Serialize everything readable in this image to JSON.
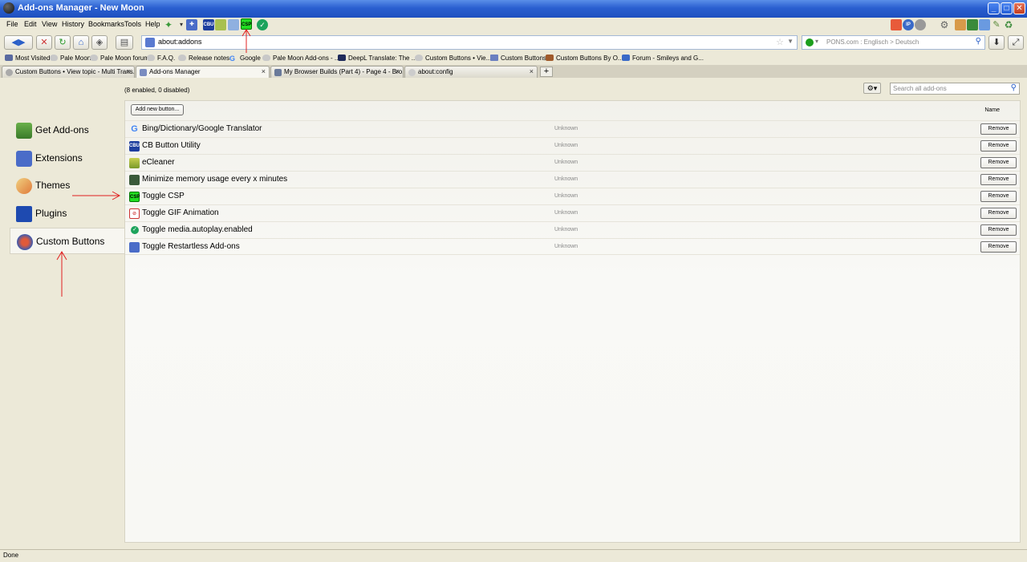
{
  "window": {
    "title": "Add-ons Manager - New Moon",
    "min": "_",
    "max": "□",
    "close": "✕"
  },
  "menu": [
    "File",
    "Edit",
    "View",
    "History",
    "Bookmarks",
    "Tools",
    "Help"
  ],
  "toolbar_icons": {
    "cbu": "CBU",
    "csp": "CSP"
  },
  "nav": {
    "url": "about:addons",
    "search_placeholder": "PONS.com : Englisch > Deutsch"
  },
  "bookmarks": [
    "Most Visited",
    "Pale Moon",
    "Pale Moon forum",
    "F.A.Q.",
    "Release notes",
    "Google",
    "Pale Moon Add-ons - ...",
    "DeepL Translate: The ...",
    "Custom Buttons • Vie...",
    "Custom Buttons",
    "Custom Buttons By O...",
    "Forum - Smileys and G..."
  ],
  "tabs": [
    {
      "label": "Custom Buttons • View topic - Multi Trans...",
      "close": "×"
    },
    {
      "label": "Add-ons Manager",
      "close": "×"
    },
    {
      "label": "My Browser Builds (Part 4) - Page 4 - Bro...",
      "close": "×"
    },
    {
      "label": "about:config",
      "close": "×"
    }
  ],
  "new_tab": "+",
  "sidebar": [
    {
      "label": "Get Add-ons"
    },
    {
      "label": "Extensions"
    },
    {
      "label": "Themes"
    },
    {
      "label": "Plugins"
    },
    {
      "label": "Custom Buttons"
    }
  ],
  "header": {
    "count": "(8 enabled, 0 disabled)",
    "search_placeholder": "Search all add-ons"
  },
  "list": {
    "add_new": "Add new button...",
    "sort_label": "Name",
    "items": [
      {
        "name": "Bing/Dictionary/Google Translator",
        "status": "Unknown",
        "remove": "Remove",
        "icon": "google-icon"
      },
      {
        "name": "CB Button Utility",
        "status": "Unknown",
        "remove": "Remove",
        "icon": "cbu-icon"
      },
      {
        "name": "eCleaner",
        "status": "Unknown",
        "remove": "Remove",
        "icon": "cleaner-icon"
      },
      {
        "name": "Minimize memory usage every x minutes",
        "status": "Unknown",
        "remove": "Remove",
        "icon": "memory-icon"
      },
      {
        "name": "Toggle CSP",
        "status": "Unknown",
        "remove": "Remove",
        "icon": "csp-icon"
      },
      {
        "name": "Toggle GIF Animation",
        "status": "Unknown",
        "remove": "Remove",
        "icon": "gif-icon"
      },
      {
        "name": "Toggle media.autoplay.enabled",
        "status": "Unknown",
        "remove": "Remove",
        "icon": "check-icon"
      },
      {
        "name": "Toggle Restartless Add-ons",
        "status": "Unknown",
        "remove": "Remove",
        "icon": "puzzle-icon"
      }
    ]
  },
  "status": "Done",
  "colors": {
    "titlebar": "#2a5fd0",
    "csp_green": "#22dd22",
    "arrow_red": "#e02020"
  }
}
